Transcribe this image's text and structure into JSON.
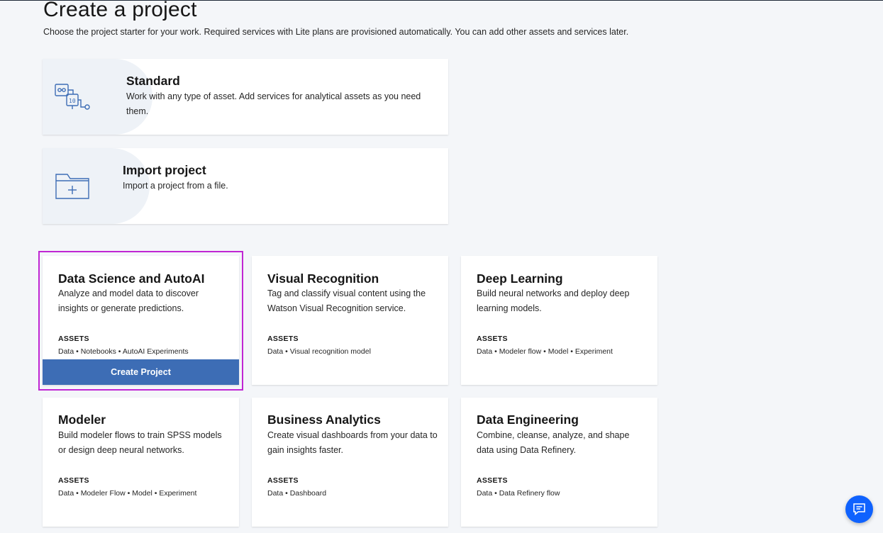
{
  "page": {
    "title": "Create a project",
    "subtitle": "Choose the project starter for your work. Required services with Lite plans are provisioned automatically. You can add other assets and services later."
  },
  "wide_tiles": {
    "standard": {
      "title": "Standard",
      "description": "Work with any type of asset. Add services for analytical assets as you need them.",
      "icon": "flow-diagram-icon"
    },
    "import": {
      "title": "Import project",
      "description": "Import a project from a file.",
      "icon": "folder-add-icon"
    }
  },
  "assets_label": "ASSETS",
  "cards": [
    {
      "title": "Data Science and AutoAI",
      "description": "Analyze and model data to discover insights or generate predictions.",
      "assets": "Data • Notebooks • AutoAI Experiments",
      "button_label": "Create Project",
      "selected": true
    },
    {
      "title": "Visual Recognition",
      "description": "Tag and classify visual content using the Watson Visual Recognition service.",
      "assets": "Data • Visual recognition model"
    },
    {
      "title": "Deep Learning",
      "description": "Build neural networks and deploy deep learning models.",
      "assets": "Data • Modeler flow • Model • Experiment"
    },
    {
      "title": "Modeler",
      "description": "Build modeler flows to train SPSS models or design deep neural networks.",
      "assets": "Data • Modeler Flow • Model • Experiment"
    },
    {
      "title": "Business Analytics",
      "description": "Create visual dashboards from your data to gain insights faster.",
      "assets": "Data • Dashboard"
    },
    {
      "title": "Data Engineering",
      "description": "Combine, cleanse, analyze, and shape data using Data Refinery.",
      "assets": "Data • Data Refinery flow"
    }
  ],
  "chat": {
    "icon": "chat-icon"
  },
  "colors": {
    "background": "#f4f6f9",
    "primary_button": "#3d6db5",
    "highlight_border": "#c026d3",
    "chat_button": "#0f62fe",
    "icon_stroke": "#3d6db5"
  }
}
